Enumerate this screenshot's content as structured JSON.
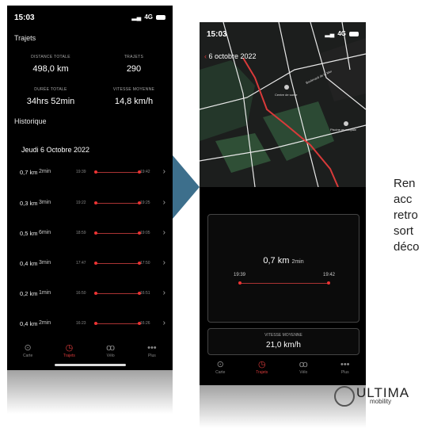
{
  "left_phone": {
    "status": {
      "time": "15:03",
      "network": "4G"
    },
    "section_title": "Trajets",
    "stats": [
      {
        "label": "DISTANCE TOTALE",
        "value": "498,0 km"
      },
      {
        "label": "TRAJETS",
        "value": "290"
      },
      {
        "label": "DURÉE TOTALE",
        "value": "34hrs 52min"
      },
      {
        "label": "VITESSE MOYENNE",
        "value": "14,8 km/h"
      }
    ],
    "history_title": "Historique",
    "day": "Jeudi 6 Octobre 2022",
    "trips": [
      {
        "distance": "0,7 km",
        "duration": "2min",
        "start": "19:39",
        "end": "19:42"
      },
      {
        "distance": "0,3 km",
        "duration": "3min",
        "start": "19:22",
        "end": "19:25"
      },
      {
        "distance": "0,5 km",
        "duration": "6min",
        "start": "18:59",
        "end": "19:05"
      },
      {
        "distance": "0,4 km",
        "duration": "3min",
        "start": "17:47",
        "end": "17:50"
      },
      {
        "distance": "0,2 km",
        "duration": "1min",
        "start": "16:50",
        "end": "16:51"
      },
      {
        "distance": "0,4 km",
        "duration": "2min",
        "start": "16:23",
        "end": "16:26"
      }
    ],
    "tabs": [
      "Carte",
      "Trajets",
      "Vélo",
      "Plus"
    ]
  },
  "right_phone": {
    "status": {
      "time": "15:03",
      "network": "4G"
    },
    "map_date": "6 octobre 2022",
    "map_labels": [
      "Centre de sante",
      "Boulevard de la Mer",
      "Piscine municipale"
    ],
    "trip_distance": "0,7 km",
    "trip_duration": "2min",
    "trip_start": "19:39",
    "trip_end": "19:42",
    "speed_label": "VITESSE MOYENNE",
    "speed_value": "21,0 km/h",
    "tabs": [
      "Carte",
      "Trajets",
      "Vélo",
      "Plus"
    ]
  },
  "side_text_lines": [
    "Ren",
    "acc",
    "retro",
    "sort",
    "déco"
  ],
  "logo": {
    "name": "ULTIMA",
    "sub": "mobility"
  },
  "colors": {
    "accent": "#d93a3a",
    "arrow": "#3d6f8c"
  }
}
